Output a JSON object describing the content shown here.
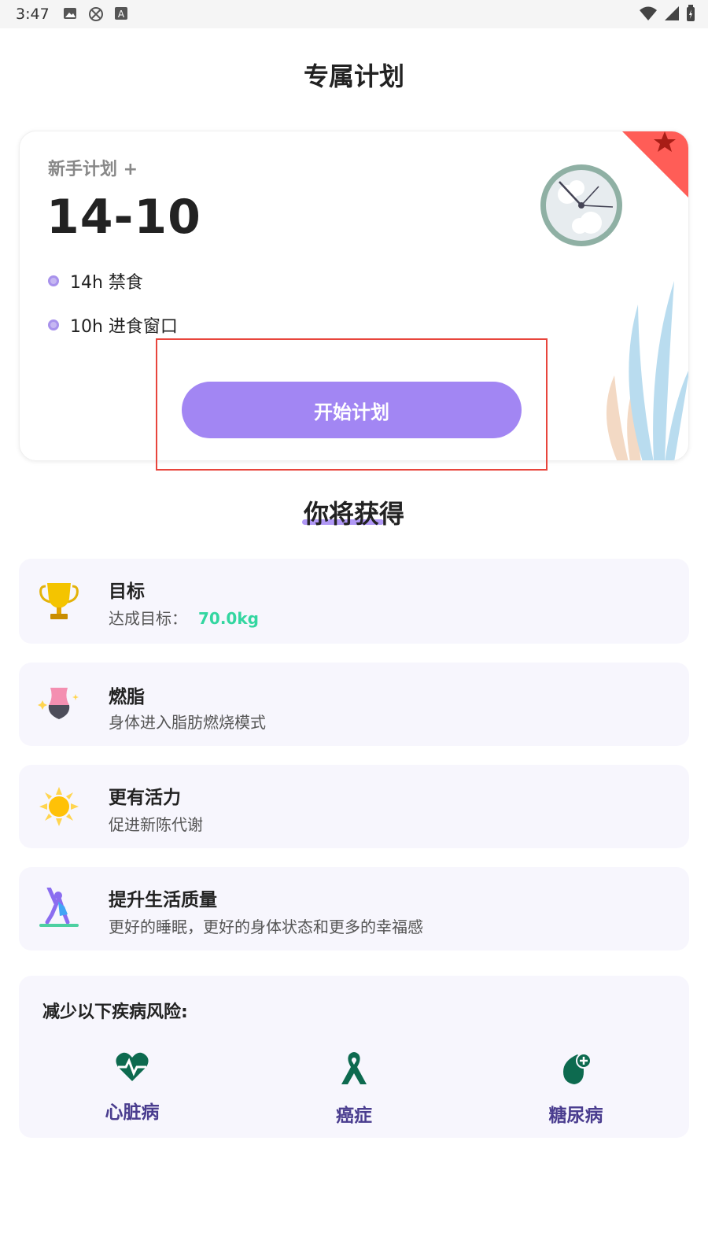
{
  "status_bar": {
    "time": "3:47",
    "icons": [
      "image-icon",
      "compass-icon",
      "text-a-icon",
      "wifi-icon",
      "signal-icon",
      "battery-icon"
    ]
  },
  "page": {
    "title": "专属计划"
  },
  "plan": {
    "subtitle": "新手计划 +",
    "ratio": "14-10",
    "bullets": [
      "14h 禁食",
      "10h 进食窗口"
    ],
    "start_button": "开始计划"
  },
  "gains": {
    "title": "你将获得",
    "items": [
      {
        "icon": "trophy-icon",
        "title": "目标",
        "desc": "达成目标：",
        "value": "70.0kg"
      },
      {
        "icon": "waist-icon",
        "title": "燃脂",
        "desc": "身体进入脂肪燃烧模式"
      },
      {
        "icon": "sun-icon",
        "title": "更有活力",
        "desc": "促进新陈代谢"
      },
      {
        "icon": "exercise-person-icon",
        "title": "提升生活质量",
        "desc": "更好的睡眠，更好的身体状态和更多的幸福感"
      }
    ]
  },
  "risks": {
    "title": "减少以下疾病风险:",
    "items": [
      {
        "icon": "heart-pulse-icon",
        "label": "心脏病"
      },
      {
        "icon": "ribbon-icon",
        "label": "癌症"
      },
      {
        "icon": "drop-plus-icon",
        "label": "糖尿病"
      }
    ]
  },
  "colors": {
    "accent": "#a286f3",
    "goal_value": "#33d6a0",
    "risk_icon": "#0d6a4f",
    "risk_label": "#4a3d8f",
    "card_bg": "#f7f6fd",
    "highlight": "#e8453c"
  }
}
